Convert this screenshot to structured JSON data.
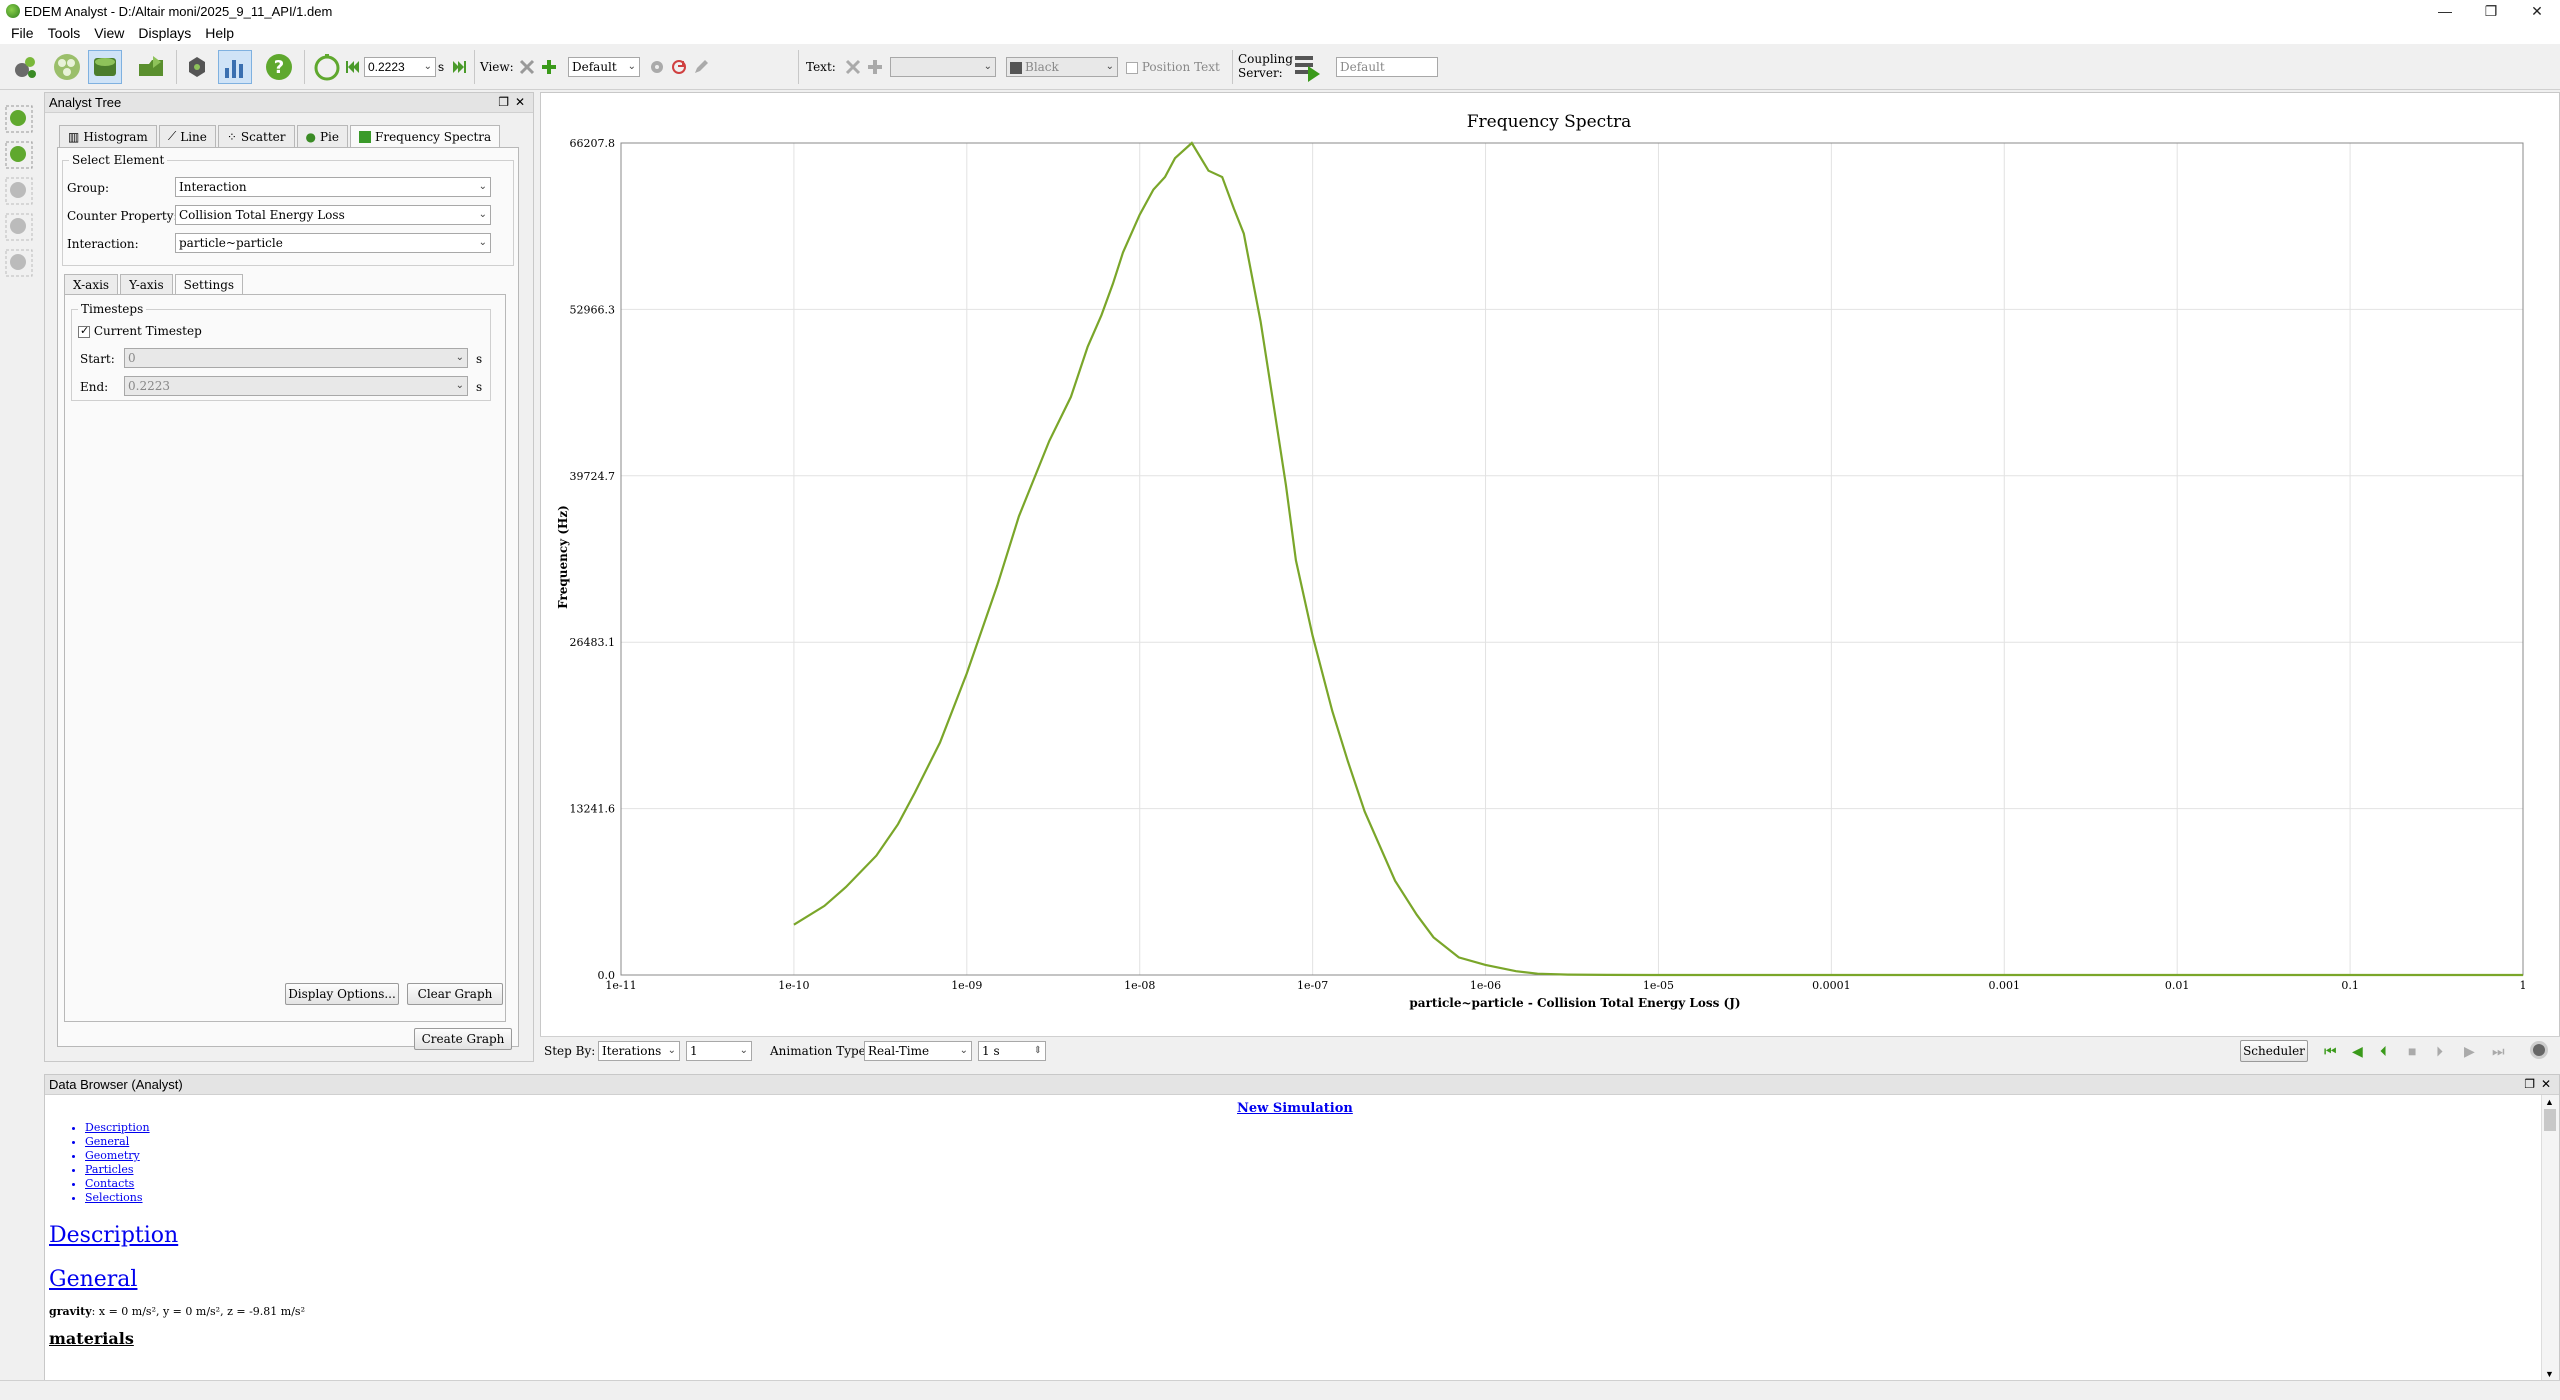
{
  "window": {
    "title": "EDEM Analyst - D:/Altair moni/2025_9_11_API/1.dem",
    "controls": [
      "—",
      "❐",
      "✕"
    ]
  },
  "menu": [
    "File",
    "Tools",
    "View",
    "Displays",
    "Help"
  ],
  "toolbar": {
    "time_value": "0.2223",
    "time_unit": "s",
    "view_label": "View:",
    "view_value": "Default",
    "text_label": "Text:",
    "color_value": "Black",
    "position_text_label": "Position Text",
    "coupling_label_1": "Coupling",
    "coupling_label_2": "Server:",
    "server_value": "Default"
  },
  "analyst_tree": {
    "title": "Analyst Tree",
    "tabs": [
      "Histogram",
      "Line",
      "Scatter",
      "Pie",
      "Frequency Spectra"
    ],
    "select_element_title": "Select Element",
    "group_label": "Group:",
    "group_value": "Interaction",
    "counter_label": "Counter Property:",
    "counter_value": "Collision Total Energy Loss",
    "interaction_label": "Interaction:",
    "interaction_value": "particle~particle",
    "subtabs": [
      "X-axis",
      "Y-axis",
      "Settings"
    ],
    "timesteps_title": "Timesteps",
    "current_timestep_label": "Current Timestep",
    "start_label": "Start:",
    "start_value": "0",
    "start_unit": "s",
    "end_label": "End:",
    "end_value": "0.2223",
    "end_unit": "s",
    "display_options_button": "Display Options...",
    "clear_graph_button": "Clear Graph",
    "create_graph_button": "Create Graph"
  },
  "stepbar": {
    "step_by_label": "Step By:",
    "step_by_value": "Iterations",
    "step_value": "1",
    "animation_label": "Animation Type:",
    "animation_value": "Real-Time",
    "anim_step": "1 s",
    "scheduler_button": "Scheduler"
  },
  "data_browser": {
    "title": "Data Browser (Analyst)",
    "heading": "New Simulation",
    "toc": [
      "Description",
      "General",
      "Geometry",
      "Particles",
      "Contacts",
      "Selections"
    ],
    "sections": [
      "Description",
      "General"
    ],
    "gravity_label": "gravity",
    "gravity_text": ": x = 0 m/s², y = 0 m/s², z = -9.81 m/s²",
    "materials": "materials"
  },
  "colors": {
    "curve": "#7aa62a",
    "accent": "#3a8b25",
    "grid": "#e2e2e2"
  },
  "chart_data": {
    "type": "line",
    "title": "Frequency Spectra",
    "xlabel": "particle~particle - Collision Total Energy Loss (J)",
    "ylabel": "Frequency (Hz)",
    "xscale": "log",
    "xlim": [
      1e-11,
      1
    ],
    "ylim": [
      0,
      66207.8
    ],
    "xticks": [
      "1e-11",
      "1e-10",
      "1e-09",
      "1e-08",
      "1e-07",
      "1e-06",
      "1e-05",
      "0.0001",
      "0.001",
      "0.01",
      "0.1",
      "1"
    ],
    "yticks": [
      "0.0",
      "13241.6",
      "26483.1",
      "39724.7",
      "52966.3",
      "66207.8"
    ],
    "grid": true,
    "series": [
      {
        "x": [
          1e-10,
          1.5e-10,
          2e-10,
          3e-10,
          4e-10,
          5e-10,
          7e-10,
          1e-09,
          1.5e-09,
          2e-09,
          3e-09,
          4e-09,
          5e-09,
          6e-09,
          7e-09,
          8e-09,
          1e-08,
          1.2e-08,
          1.4e-08,
          1.6e-08,
          2e-08,
          2.5e-08,
          3e-08,
          3.5e-08,
          4e-08,
          5e-08,
          6e-08,
          7e-08,
          8e-08,
          1e-07,
          1.3e-07,
          1.6e-07,
          2e-07,
          3e-07,
          4e-07,
          5e-07,
          7e-07,
          1e-06,
          1.5e-06,
          2e-06,
          3e-06,
          5e-06,
          1e-05,
          0.0001,
          0.001,
          0.01,
          0.1,
          1
        ],
        "y": [
          4000,
          5500,
          7000,
          9500,
          12000,
          14500,
          18500,
          24000,
          31000,
          36500,
          42500,
          46000,
          50000,
          52500,
          55000,
          57500,
          60500,
          62500,
          63500,
          65000,
          66207,
          64000,
          63500,
          61000,
          59000,
          52000,
          45000,
          39000,
          33000,
          27000,
          21000,
          17000,
          13000,
          7500,
          4800,
          3000,
          1400,
          800,
          300,
          100,
          30,
          10,
          0,
          0,
          0,
          0,
          0,
          0
        ]
      }
    ]
  }
}
